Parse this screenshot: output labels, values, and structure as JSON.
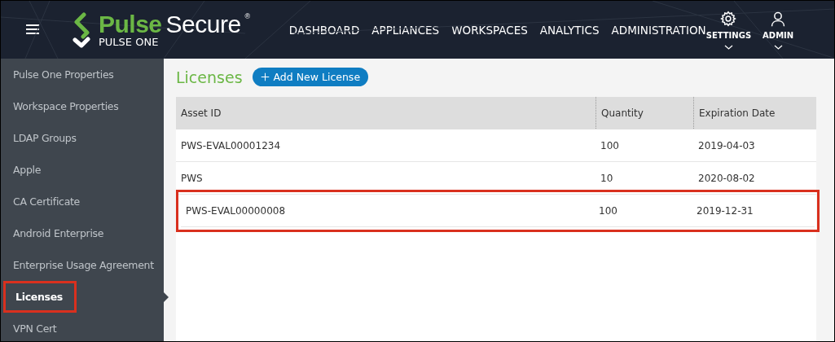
{
  "brand": {
    "word_1": "Pulse",
    "word_2": "Secure",
    "mark": "®",
    "product": "PULSE ONE"
  },
  "nav": [
    {
      "label": "DASHBOARD"
    },
    {
      "label": "APPLIANCES"
    },
    {
      "label": "WORKSPACES"
    },
    {
      "label": "ANALYTICS"
    },
    {
      "label": "ADMINISTRATION"
    }
  ],
  "user_menus": [
    {
      "kind": "settings",
      "label": "SETTINGS"
    },
    {
      "kind": "user",
      "label": "ADMIN"
    }
  ],
  "sidebar": {
    "items": [
      {
        "label": "Pulse One Properties",
        "selected": false
      },
      {
        "label": "Workspace Properties",
        "selected": false
      },
      {
        "label": "LDAP Groups",
        "selected": false
      },
      {
        "label": "Apple",
        "selected": false
      },
      {
        "label": "CA Certificate",
        "selected": false
      },
      {
        "label": "Android Enterprise",
        "selected": false
      },
      {
        "label": "Enterprise Usage Agreement",
        "selected": false
      },
      {
        "label": "Licenses",
        "selected": true
      },
      {
        "label": "VPN Cert",
        "selected": false
      }
    ]
  },
  "page": {
    "title": "Licenses",
    "add_button": "Add New License"
  },
  "table": {
    "columns": [
      "Asset ID",
      "Quantity",
      "Expiration Date"
    ],
    "rows": [
      {
        "cells": [
          "PWS-EVAL00001234",
          "100",
          "2019-04-03"
        ],
        "highlighted": false
      },
      {
        "cells": [
          "PWS",
          "10",
          "2020-08-02"
        ],
        "highlighted": false
      },
      {
        "cells": [
          "PWS-EVAL00000008",
          "100",
          "2019-12-31"
        ],
        "highlighted": true
      }
    ]
  }
}
